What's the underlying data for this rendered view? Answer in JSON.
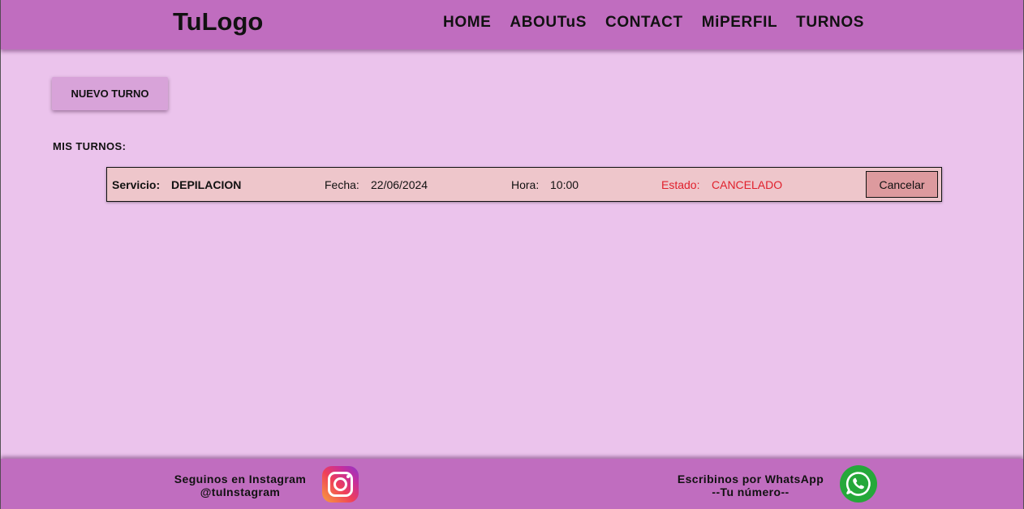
{
  "header": {
    "logo": "TuLogo",
    "nav": [
      "HOME",
      "ABOUTuS",
      "CONTACT",
      "MiPERFIL",
      "TURNOS"
    ]
  },
  "main": {
    "new_button": "NUEVO TURNO",
    "section_title": "MIS TURNOS:",
    "turno": {
      "servicio_label": "Servicio:",
      "servicio": "DEPILACION",
      "fecha_label": "Fecha:",
      "fecha": "22/06/2024",
      "hora_label": "Hora:",
      "hora": "10:00",
      "estado_label": "Estado:",
      "estado": "CANCELADO",
      "cancel_button": "Cancelar"
    }
  },
  "footer": {
    "instagram_line1": "Seguinos en Instagram",
    "instagram_line2": "@tuInstagram",
    "whatsapp_line1": "Escribinos por WhatsApp",
    "whatsapp_line2": "--Tu número--",
    "icons": [
      "instagram-icon",
      "whatsapp-icon"
    ]
  },
  "colors": {
    "header_footer": "#c06dbf",
    "background": "#ebc3ec",
    "row_background": "#eec6cb",
    "status_red": "#e0202c",
    "whatsapp_green": "#25a83a"
  }
}
